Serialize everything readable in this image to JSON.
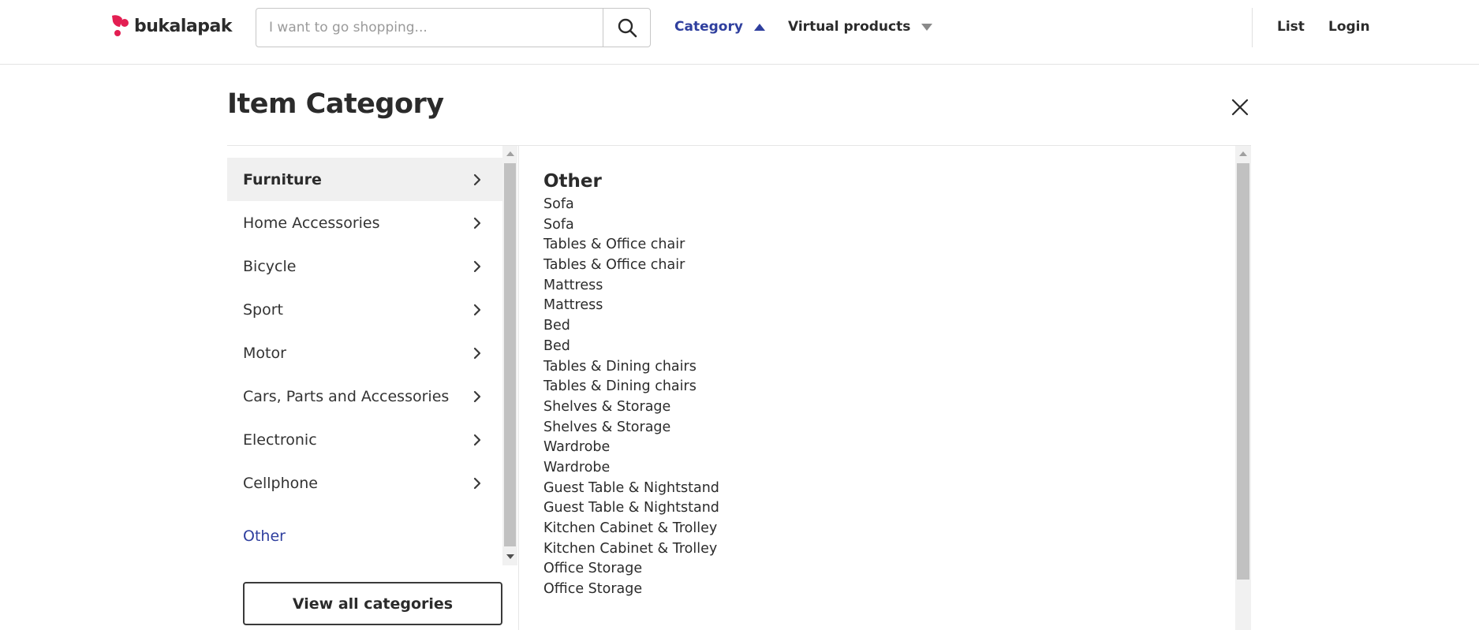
{
  "header": {
    "brand": "bukalapak",
    "search": {
      "placeholder": "I want to go shopping...",
      "value": ""
    },
    "nav": {
      "category": "Category",
      "virtual_products": "Virtual products",
      "list": "List",
      "login": "Login"
    }
  },
  "panel": {
    "title": "Item Category",
    "categories": [
      {
        "label": "Furniture",
        "active": true
      },
      {
        "label": "Home Accessories",
        "active": false
      },
      {
        "label": "Bicycle",
        "active": false
      },
      {
        "label": "Sport",
        "active": false
      },
      {
        "label": "Motor",
        "active": false
      },
      {
        "label": "Cars, Parts and Accessories",
        "active": false
      },
      {
        "label": "Electronic",
        "active": false
      },
      {
        "label": "Cellphone",
        "active": false
      }
    ],
    "other_link": "Other",
    "view_all_label": "View all categories",
    "subcategory": {
      "title": "Other",
      "items": [
        "Sofa",
        "Sofa",
        "Tables & Office chair",
        "Tables & Office chair",
        "Mattress",
        "Mattress",
        "Bed",
        "Bed",
        "Tables & Dining chairs",
        "Tables & Dining chairs",
        "Shelves & Storage",
        "Shelves & Storage",
        "Wardrobe",
        "Wardrobe",
        "Guest Table & Nightstand",
        "Guest Table & Nightstand",
        "Kitchen Cabinet & Trolley",
        "Kitchen Cabinet & Trolley",
        "Office Storage",
        "Office Storage"
      ]
    }
  },
  "colors": {
    "brand": "#e31e52",
    "accent": "#2f3f9e",
    "text": "#2b2b2b"
  },
  "icons": {
    "search": "search-icon",
    "close": "close-icon",
    "chevron": "chevron-right-icon",
    "caret_up": "caret-up-icon",
    "caret_down": "caret-down-icon"
  }
}
